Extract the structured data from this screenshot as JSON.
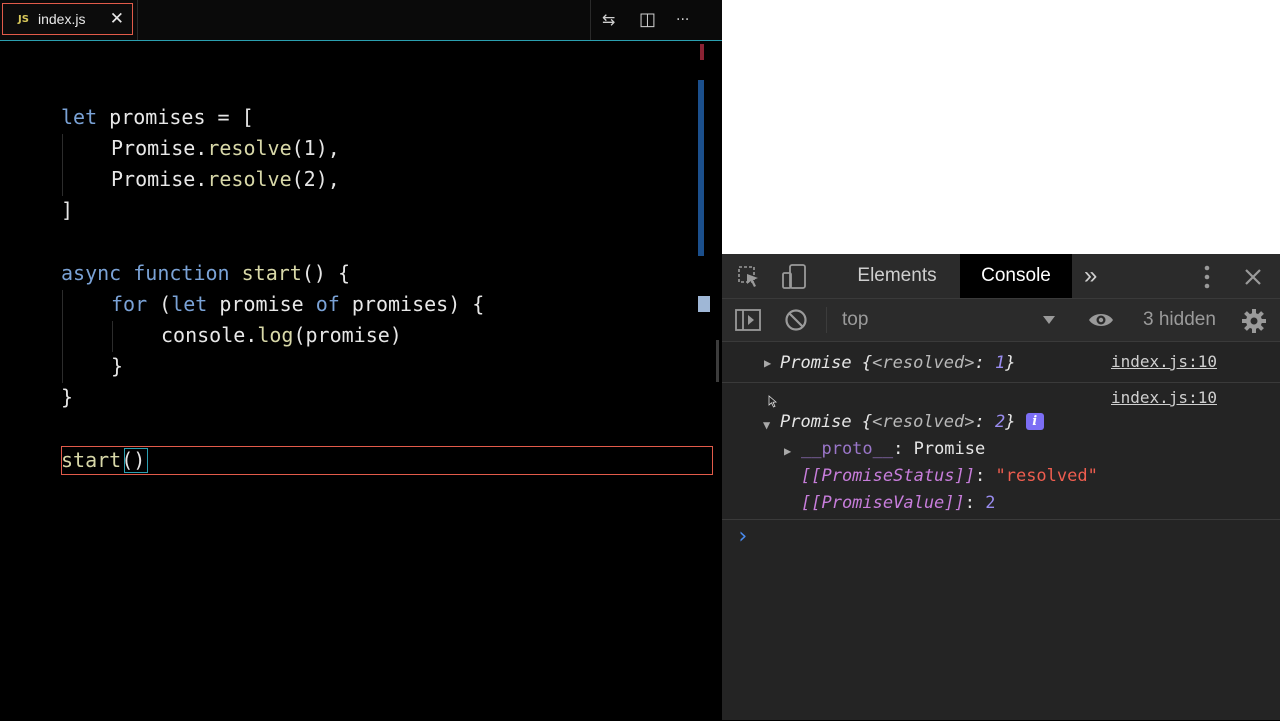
{
  "editor": {
    "tab": {
      "icon_label": "JS",
      "filename": "index.js",
      "close_glyph": "✕"
    },
    "toolbar": {
      "compare_glyph": "⇆",
      "split_glyph": "◫",
      "more_glyph": "···"
    },
    "code": {
      "l1": {
        "kw": "let",
        "name": "promises",
        "rest": " = ["
      },
      "l2": {
        "obj": "Promise",
        "dot": ".",
        "method": "resolve",
        "args": "(1),"
      },
      "l3": {
        "obj": "Promise",
        "dot": ".",
        "method": "resolve",
        "args": "(2),"
      },
      "l4": "]",
      "l6": {
        "kw1": "async",
        "kw2": "function",
        "fn": "start",
        "rest": "() {"
      },
      "l7": {
        "kw": "for",
        "p1": " (",
        "kw2": "let",
        "v1": "promise",
        "kw3": "of",
        "v2": "promises",
        "rest": ") {"
      },
      "l8": {
        "obj": "console",
        "dot": ".",
        "method": "log",
        "args": "(promise)"
      },
      "l9": "}",
      "l10": "}",
      "l12": {
        "fn": "start",
        "args": "()"
      }
    }
  },
  "devtools": {
    "tabs": {
      "elements": "Elements",
      "console": "Console",
      "more": "»"
    },
    "toolbar": {
      "context": "top",
      "hidden": "3 hidden"
    },
    "entries": [
      {
        "prefix": "Promise ",
        "open": "{",
        "key": "<resolved>",
        "colon": ": ",
        "value": "1",
        "close": "}",
        "source": "index.js:10"
      },
      {
        "prefix": "Promise ",
        "open": "{",
        "key": "<resolved>",
        "colon": ": ",
        "value": "2",
        "close": "}",
        "source": "index.js:10"
      }
    ],
    "expanded": {
      "proto_key": "__proto__",
      "proto_val": ": Promise",
      "status_key": "[[PromiseStatus]]",
      "status_colon": ": ",
      "status_val": "\"resolved\"",
      "value_key": "[[PromiseValue]]",
      "value_colon": ": ",
      "value_val": "2"
    },
    "info_badge": "i",
    "prompt": "›"
  },
  "colors": {
    "accent_teal": "#2b9fb0",
    "highlight_red": "#e25b4a",
    "keyword_blue": "#7aa2d6"
  }
}
